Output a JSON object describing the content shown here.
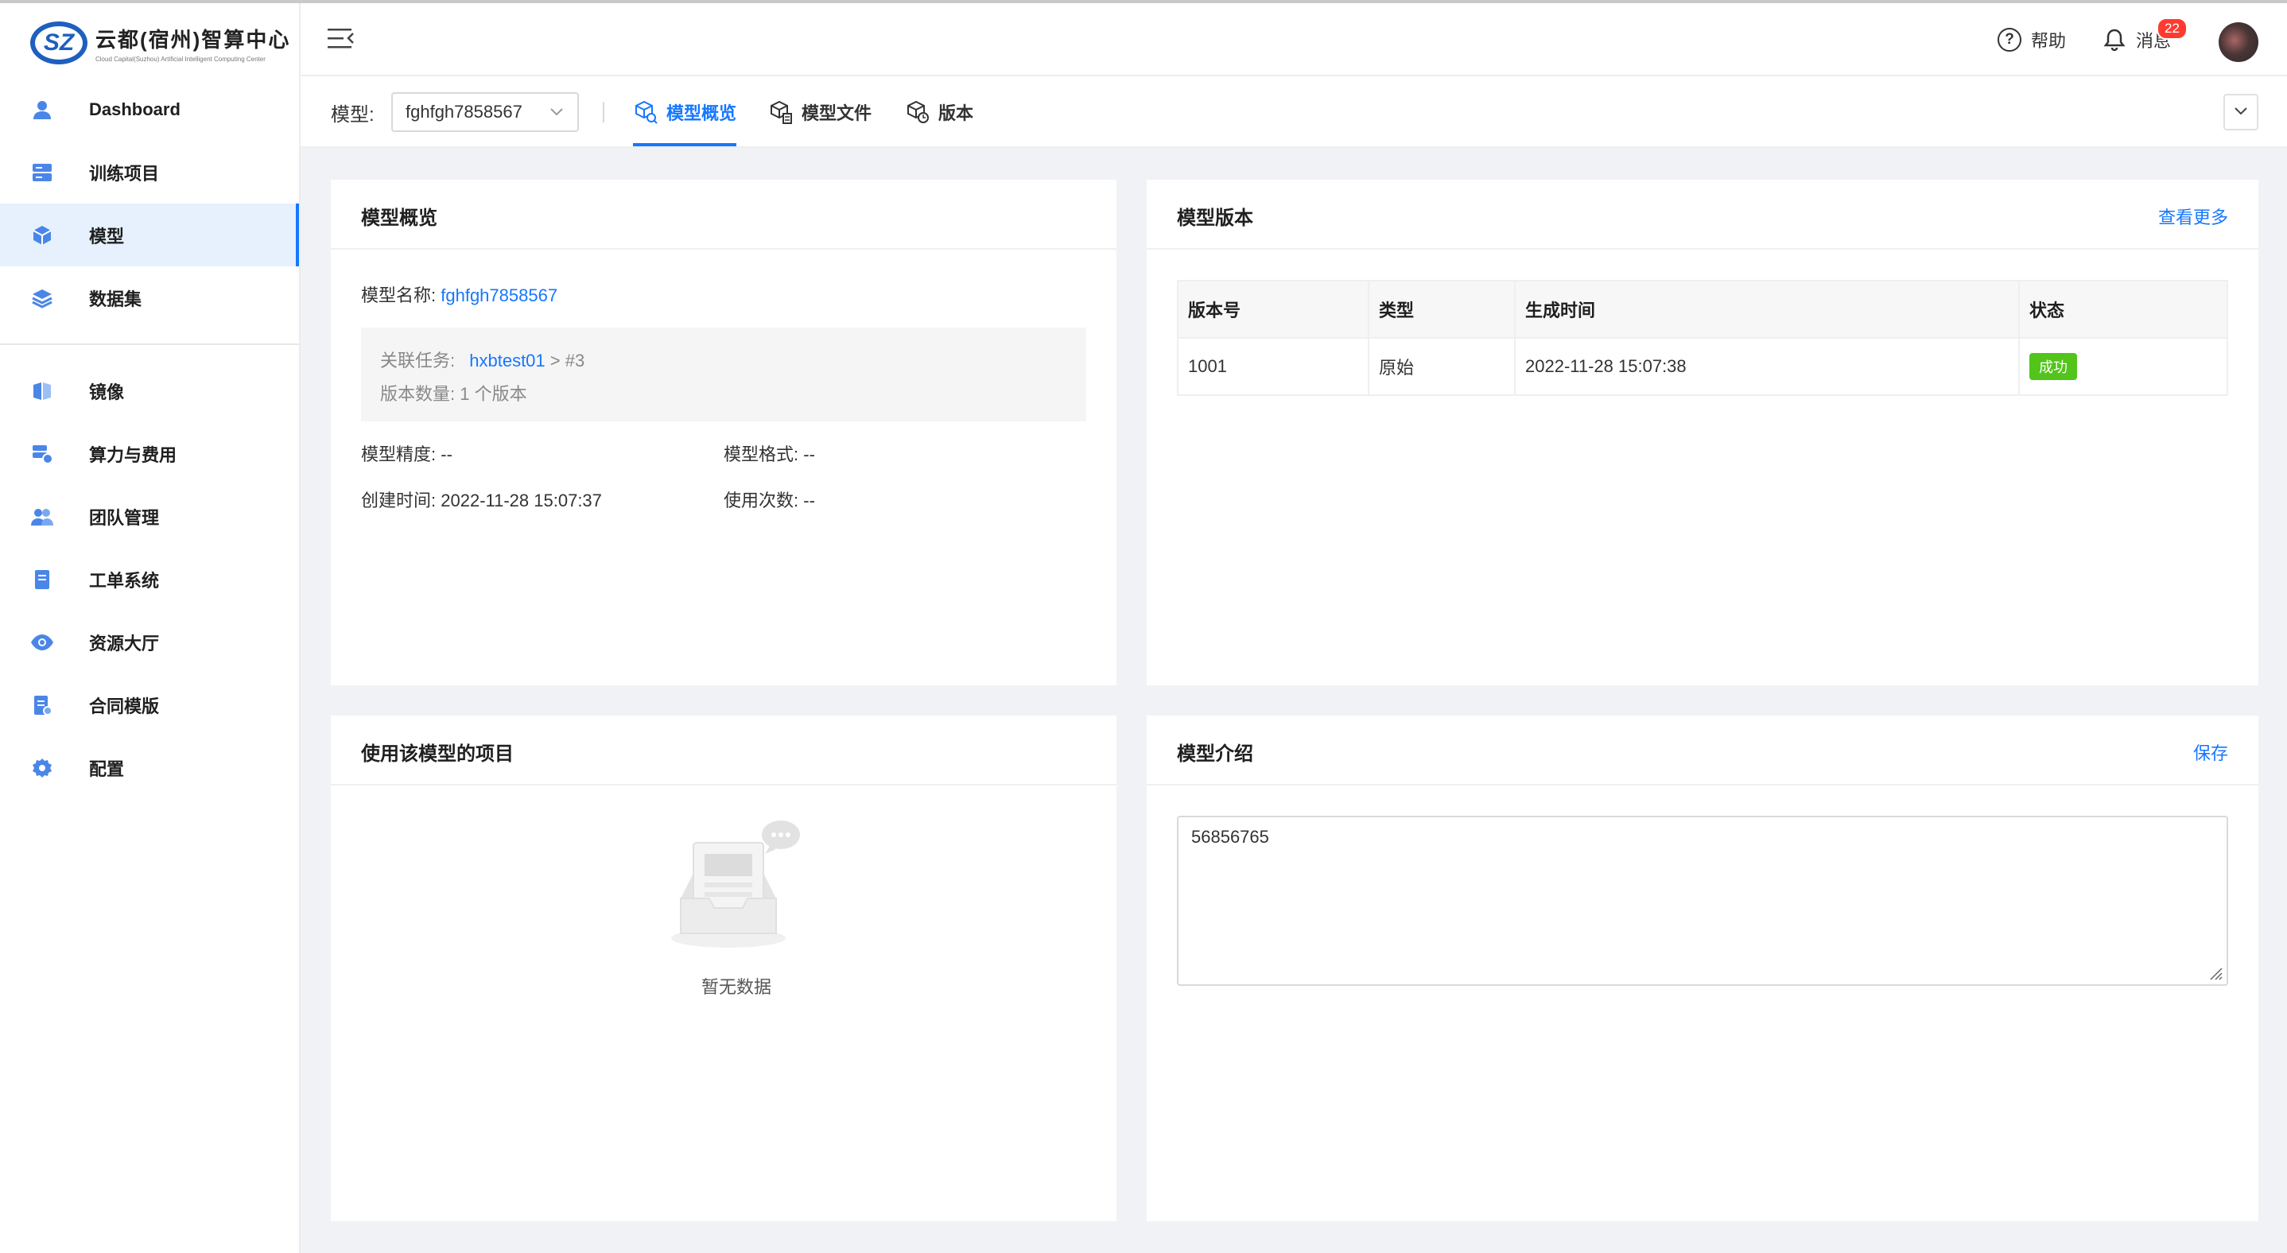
{
  "brand": {
    "logo_mark": "SZ",
    "title": "云都(宿州)智算中心",
    "subtitle": "Cloud Capital(Suzhou) Artificial Intelligent Computing Center"
  },
  "sidebar": {
    "items": [
      {
        "label": "Dashboard",
        "icon": "user-icon"
      },
      {
        "label": "训练项目",
        "icon": "server-icon"
      },
      {
        "label": "模型",
        "icon": "cube-icon",
        "active": true
      },
      {
        "label": "数据集",
        "icon": "layers-icon"
      },
      {
        "label": "镜像",
        "icon": "image-icon"
      },
      {
        "label": "算力与费用",
        "icon": "billing-icon"
      },
      {
        "label": "团队管理",
        "icon": "team-icon"
      },
      {
        "label": "工单系统",
        "icon": "ticket-icon"
      },
      {
        "label": "资源大厅",
        "icon": "eye-icon"
      },
      {
        "label": "合同模版",
        "icon": "contract-icon"
      },
      {
        "label": "配置",
        "icon": "gear-icon"
      }
    ]
  },
  "header": {
    "help_label": "帮助",
    "help_glyph": "?",
    "messages_label": "消息",
    "messages_count": "22"
  },
  "tabbar": {
    "model_label": "模型:",
    "model_value": "fghfgh7858567",
    "tabs": [
      {
        "label": "模型概览",
        "icon": "cube-search-icon",
        "active": true
      },
      {
        "label": "模型文件",
        "icon": "cube-file-icon"
      },
      {
        "label": "版本",
        "icon": "cube-version-icon"
      }
    ]
  },
  "overview": {
    "title": "模型概览",
    "name_label": "模型名称:",
    "name_value": "fghfgh7858567",
    "task_label": "关联任务:",
    "task_link": "hxbtest01",
    "task_suffix": " > #3",
    "version_count": "版本数量: 1 个版本",
    "precision_label": "模型精度:",
    "precision_value": "--",
    "format_label": "模型格式:",
    "format_value": "--",
    "created_label": "创建时间:",
    "created_value": "2022-11-28 15:07:37",
    "usage_label": "使用次数:",
    "usage_value": "--"
  },
  "versions": {
    "title": "模型版本",
    "more_link": "查看更多",
    "columns": [
      "版本号",
      "类型",
      "生成时间",
      "状态"
    ],
    "rows": [
      {
        "version": "1001",
        "type": "原始",
        "time": "2022-11-28 15:07:38",
        "status": "成功"
      }
    ],
    "status_color": "#52c41a"
  },
  "projects": {
    "title": "使用该模型的项目",
    "empty_text": "暂无数据"
  },
  "intro": {
    "title": "模型介绍",
    "save_link": "保存",
    "text": "56856765"
  },
  "colors": {
    "accent": "#1677ff",
    "active_nav_bg": "#e6f1fd",
    "page_bg": "#f0f2f5",
    "badge": "#ff3b30"
  }
}
